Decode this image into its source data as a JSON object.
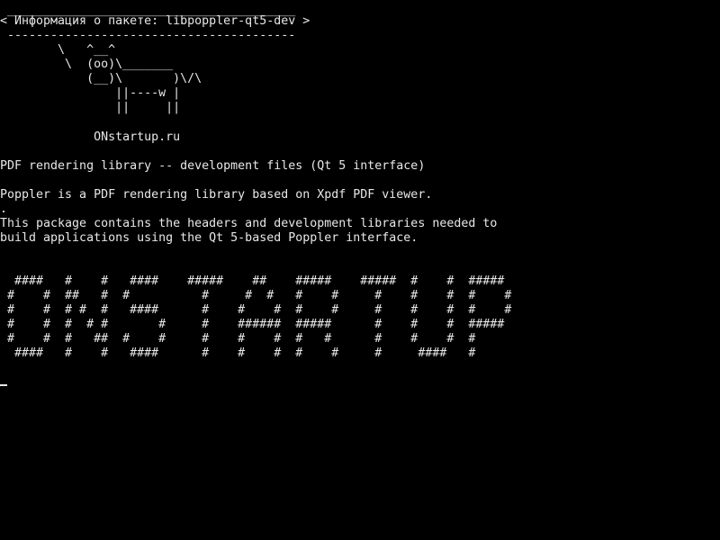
{
  "cowsay": {
    "rule_top": " ________________________________________",
    "speech": "< Информация о пакете: libpoppler-qt5-dev >",
    "rule_bottom": " ----------------------------------------",
    "cow_lines": [
      "        \\   ^__^",
      "         \\  (oo)\\_______",
      "            (__)\\       )\\/\\",
      "                ||----w |",
      "                ||     ||"
    ],
    "site": "             ONstartup.ru"
  },
  "package": {
    "summary": "PDF rendering library -- development files (Qt 5 interface)",
    "description_1": "Poppler is a PDF rendering library based on Xpdf PDF viewer.",
    "separator": ".",
    "description_2": "This package contains the headers and development libraries needed to",
    "description_3": "build applications using the Qt 5-based Poppler interface."
  },
  "banner": {
    "lines": [
      "  ####   #    #   ####    #####    ##    #####    #####  #    #  #####",
      " #    #  ##   #  #          #     #  #   #    #     #    #    #  #    #",
      " #    #  # #  #   ####      #    #    #  #    #     #    #    #  #    #",
      " #    #  #  # #       #     #    ######  #####      #    #    #  #####",
      " #    #  #   ##  #    #     #    #    #  #   #      #    #    #  #",
      "  ####   #    #   ####      #    #    #  #    #     #     ####   #"
    ]
  }
}
